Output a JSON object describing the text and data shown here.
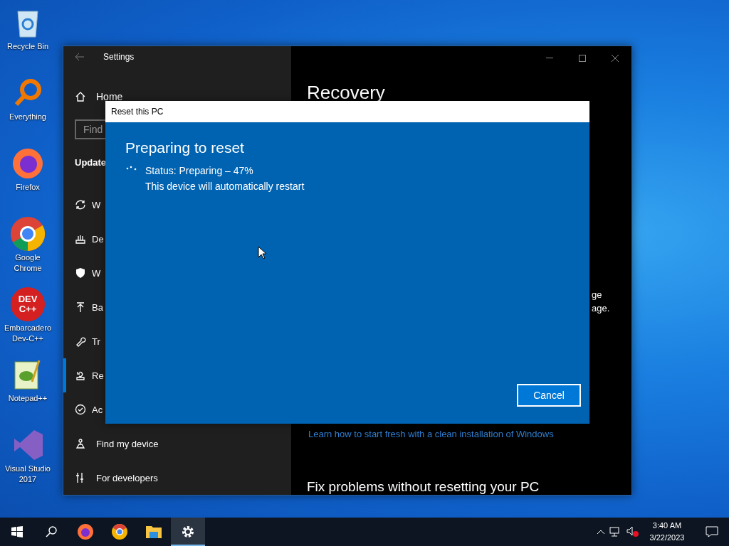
{
  "desktop_icons": [
    {
      "label": "Recycle Bin"
    },
    {
      "label": "Everything"
    },
    {
      "label": "Firefox"
    },
    {
      "label": "Google Chrome"
    },
    {
      "label": "Embarcadero Dev-C++",
      "logo_text": "DEV C++"
    },
    {
      "label": "Notepad++"
    },
    {
      "label": "Visual Studio 2017"
    }
  ],
  "settings_window": {
    "title": "Settings",
    "sidebar": {
      "home": "Home",
      "search_placeholder": "Find",
      "section": "Update",
      "items": [
        {
          "label": "W",
          "selected": false
        },
        {
          "label": "De",
          "selected": false
        },
        {
          "label": "W",
          "selected": false
        },
        {
          "label": "Ba",
          "selected": false
        },
        {
          "label": "Tr",
          "selected": false
        },
        {
          "label": "Re",
          "selected": true
        },
        {
          "label": "Ac",
          "selected": false
        },
        {
          "label": "Find my device",
          "selected": false
        },
        {
          "label": "For developers",
          "selected": false
        }
      ]
    },
    "content": {
      "title": "Recovery",
      "fragment_1": "ge",
      "fragment_2": "age.",
      "link": "Learn how to start fresh with a clean installation of Windows",
      "heading": "Fix problems without resetting your PC"
    }
  },
  "dialog": {
    "title": "Reset this PC",
    "heading": "Preparing to reset",
    "status": "Status: Preparing – 47%",
    "note": "This device will automatically restart",
    "button": "Cancel"
  },
  "taskbar": {
    "apps": [
      {
        "kind": "firefox",
        "selected": false
      },
      {
        "kind": "chrome",
        "selected": false
      },
      {
        "kind": "explorer",
        "selected": false
      },
      {
        "kind": "settings",
        "selected": true
      }
    ],
    "time": "3:40 AM",
    "date": "3/22/2023"
  }
}
